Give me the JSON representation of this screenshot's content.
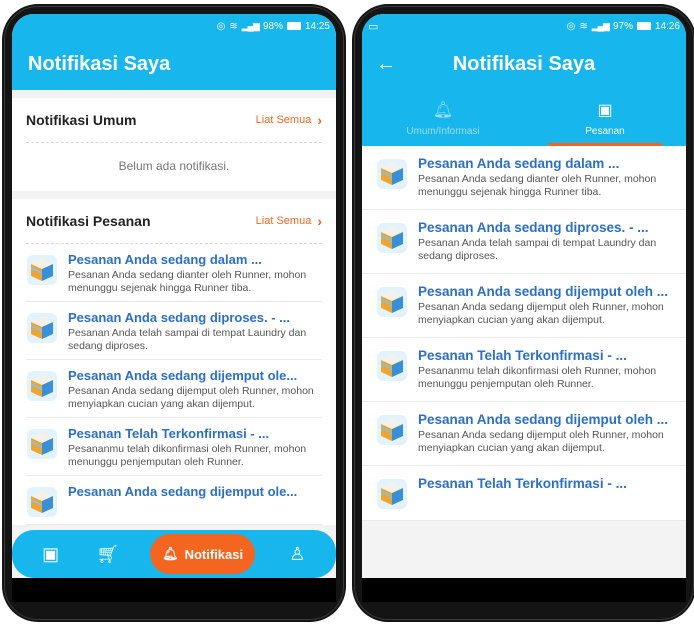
{
  "left": {
    "status": {
      "battery": "98%",
      "time": "14:25"
    },
    "title": "Notifikasi Saya",
    "umum": {
      "title": "Notifikasi Umum",
      "see_all": "Liat Semua",
      "empty": "Belum ada notifikasi."
    },
    "pesanan": {
      "title": "Notifikasi Pesanan",
      "see_all": "Liat Semua",
      "items": [
        {
          "title": "Pesanan Anda sedang dalam ...",
          "body": "Pesanan Anda sedang dianter oleh Runner, mohon menunggu sejenak hingga Runner tiba."
        },
        {
          "title": "Pesanan Anda sedang diproses. - ...",
          "body": "Pesanan Anda telah sampai di tempat Laundry dan sedang diproses."
        },
        {
          "title": "Pesanan Anda sedang dijemput ole...",
          "body": "Pesanan Anda sedang dijemput oleh Runner, mohon menyiapkan cucian yang akan dijemput."
        },
        {
          "title": "Pesanan Telah Terkonfirmasi - ...",
          "body": "Pesananmu telah dikonfirmasi oleh Runner, mohon menunggu penjemputan oleh Runner."
        },
        {
          "title": "Pesanan Anda sedang dijemput ole...",
          "body": ""
        }
      ]
    },
    "nav": {
      "active_label": "Notifikasi"
    }
  },
  "right": {
    "status": {
      "battery": "97%",
      "time": "14:26"
    },
    "title": "Notifikasi Saya",
    "tabs": [
      {
        "label": "Umum/Informasi"
      },
      {
        "label": "Pesanan"
      }
    ],
    "items": [
      {
        "title": "Pesanan Anda sedang dalam ...",
        "body": "Pesanan Anda sedang dianter oleh Runner, mohon menunggu sejenak hingga Runner tiba."
      },
      {
        "title": "Pesanan Anda sedang diproses. - ...",
        "body": "Pesanan Anda telah sampai di tempat Laundry dan sedang diproses."
      },
      {
        "title": "Pesanan Anda sedang dijemput oleh ...",
        "body": "Pesanan Anda sedang dijemput oleh Runner, mohon menyiapkan cucian yang akan dijemput."
      },
      {
        "title": "Pesanan Telah Terkonfirmasi - ...",
        "body": "Pesananmu telah dikonfirmasi oleh Runner, mohon menunggu penjemputan oleh Runner."
      },
      {
        "title": "Pesanan Anda sedang dijemput oleh ...",
        "body": "Pesanan Anda sedang dijemput oleh Runner, mohon menyiapkan cucian yang akan dijemput."
      },
      {
        "title": "Pesanan Telah Terkonfirmasi - ...",
        "body": ""
      }
    ]
  },
  "colors": {
    "primary": "#17b6ec",
    "accent": "#f4651f",
    "link": "#2c6fc7"
  },
  "icons": [
    "location-icon",
    "wifi-icon",
    "signal-icon",
    "battery-icon",
    "back-arrow-icon",
    "bell-icon",
    "washer-icon",
    "cart-icon",
    "user-icon",
    "chevron-right-icon",
    "package-icon"
  ]
}
